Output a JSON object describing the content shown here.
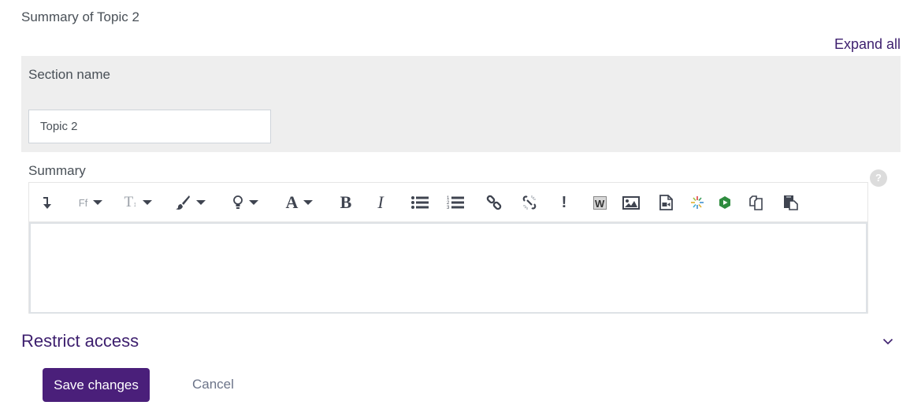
{
  "page": {
    "heading": "Summary of Topic 2",
    "expand_all": "Expand all"
  },
  "section": {
    "label": "Section name",
    "input_value": "Topic 2"
  },
  "summary": {
    "label": "Summary",
    "help_icon": "?",
    "toolbar": [
      {
        "name": "show-more-buttons-icon",
        "label": "↴"
      },
      {
        "name": "font-family-icon",
        "label": "Ff"
      },
      {
        "name": "font-size-icon",
        "label": "T"
      },
      {
        "name": "paint-brush-icon",
        "label": ""
      },
      {
        "name": "lightbulb-icon",
        "label": ""
      },
      {
        "name": "font-color-icon",
        "label": "A"
      },
      {
        "name": "bold-icon",
        "label": "B"
      },
      {
        "name": "italic-icon",
        "label": "I"
      },
      {
        "name": "unordered-list-icon",
        "label": ""
      },
      {
        "name": "ordered-list-icon",
        "label": ""
      },
      {
        "name": "link-icon",
        "label": ""
      },
      {
        "name": "unlink-icon",
        "label": ""
      },
      {
        "name": "exclamation-icon",
        "label": "!"
      },
      {
        "name": "word-import-icon",
        "label": "W"
      },
      {
        "name": "image-icon",
        "label": ""
      },
      {
        "name": "media-icon",
        "label": ""
      },
      {
        "name": "kaltura-icon",
        "label": ""
      },
      {
        "name": "panopto-icon",
        "label": ""
      },
      {
        "name": "copy-icon",
        "label": ""
      },
      {
        "name": "paste-icon",
        "label": ""
      }
    ],
    "content": ""
  },
  "restrict_access": {
    "label": "Restrict access"
  },
  "actions": {
    "save_label": "Save changes",
    "cancel_label": "Cancel"
  },
  "colors": {
    "brand": "#4a1f7a",
    "link": "#3d1f6e",
    "panel_bg": "#eeeeee"
  }
}
